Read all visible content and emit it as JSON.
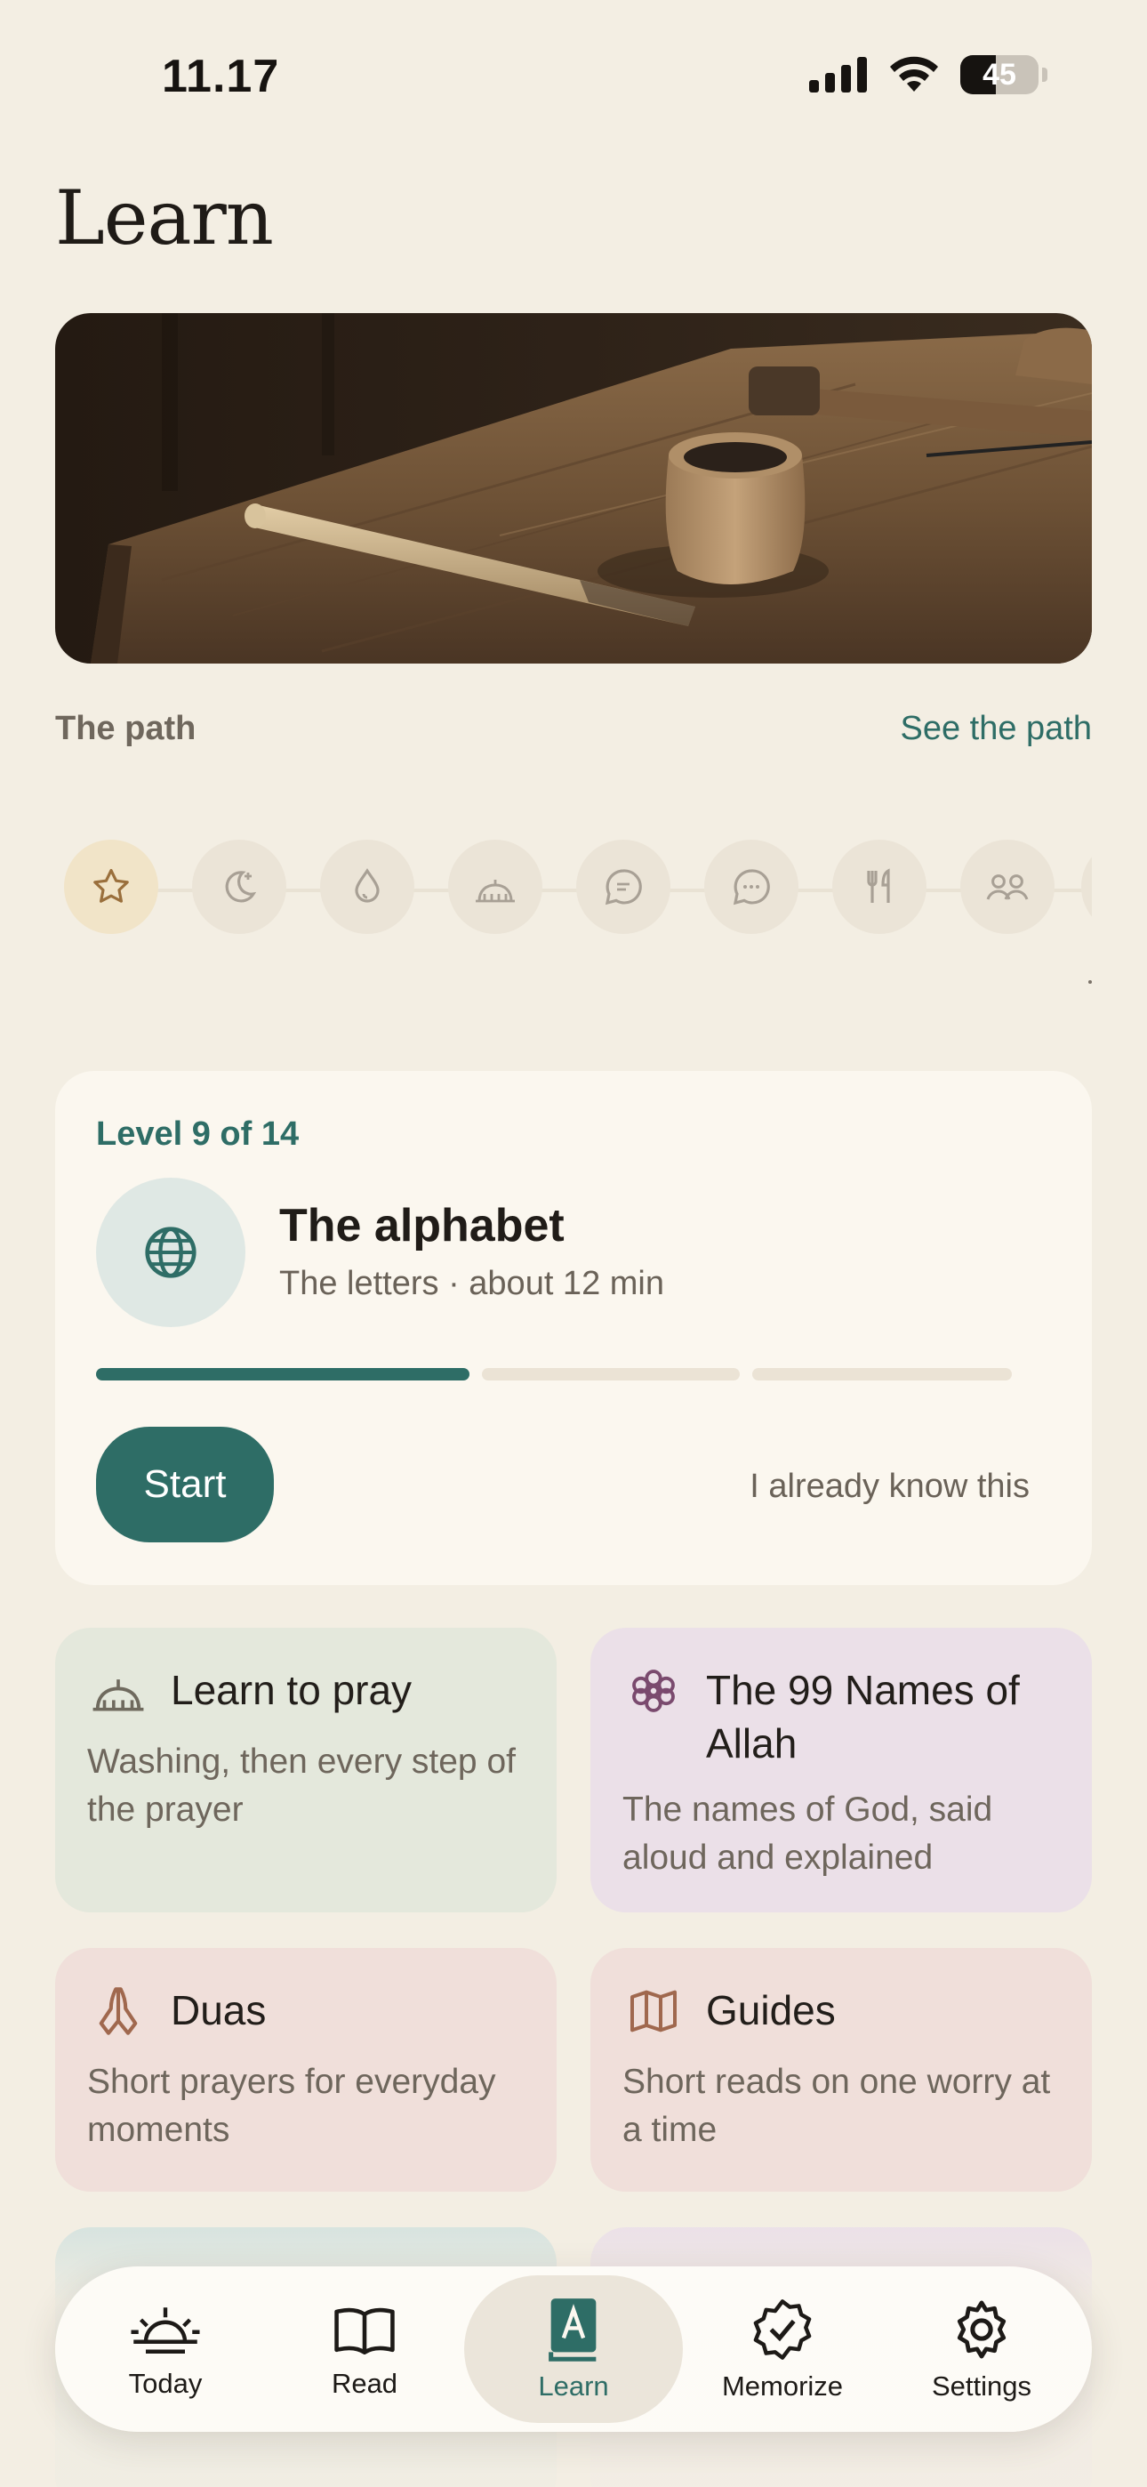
{
  "status_bar": {
    "time": "11.17",
    "battery": "45",
    "battery_fraction": 0.45
  },
  "page": {
    "title": "Learn"
  },
  "path": {
    "label": "The path",
    "link": "See the path",
    "levels": [
      {
        "icon": "star-icon",
        "active": true
      },
      {
        "icon": "moon-star-icon",
        "active": false
      },
      {
        "icon": "water-drop-icon",
        "active": false
      },
      {
        "icon": "mosque-icon",
        "active": false
      },
      {
        "icon": "chat-lines-icon",
        "active": false
      },
      {
        "icon": "chat-dots-icon",
        "active": false
      },
      {
        "icon": "fork-knife-icon",
        "active": false
      },
      {
        "icon": "people-icon",
        "active": false
      }
    ]
  },
  "level_card": {
    "kicker": "Level 9 of 14",
    "icon": "globe-icon",
    "title": "The alphabet",
    "meta": "The letters · about 12 min",
    "progress_segments": [
      1,
      0,
      0
    ],
    "start_label": "Start",
    "skip_label": "I already know this"
  },
  "tiles": [
    {
      "title": "Learn to pray",
      "desc": "Washing, then every step of the prayer",
      "icon": "mosque-icon",
      "color": "#e4e8dc"
    },
    {
      "title": "The 99 Names of Allah",
      "desc": "The names of God, said aloud and explained",
      "icon": "flower-icon",
      "color": "#ebe0e8"
    },
    {
      "title": "Duas",
      "desc": "Short prayers for everyday moments",
      "icon": "praying-hands-icon",
      "color": "#f0dfda"
    },
    {
      "title": "Guides",
      "desc": "Short reads on one worry at a time",
      "icon": "map-icon",
      "color": "#f0dfda"
    }
  ],
  "tab_bar": {
    "tabs": [
      {
        "label": "Today",
        "icon": "sunrise-icon",
        "active": false
      },
      {
        "label": "Read",
        "icon": "open-book-icon",
        "active": false
      },
      {
        "label": "Learn",
        "icon": "letter-book-icon",
        "active": true
      },
      {
        "label": "Memorize",
        "icon": "badge-check-icon",
        "active": false
      },
      {
        "label": "Settings",
        "icon": "gear-icon",
        "active": false
      }
    ]
  },
  "colors": {
    "accent": "#2e6d66",
    "background": "#f3eee3",
    "card": "#fbf7ef"
  }
}
